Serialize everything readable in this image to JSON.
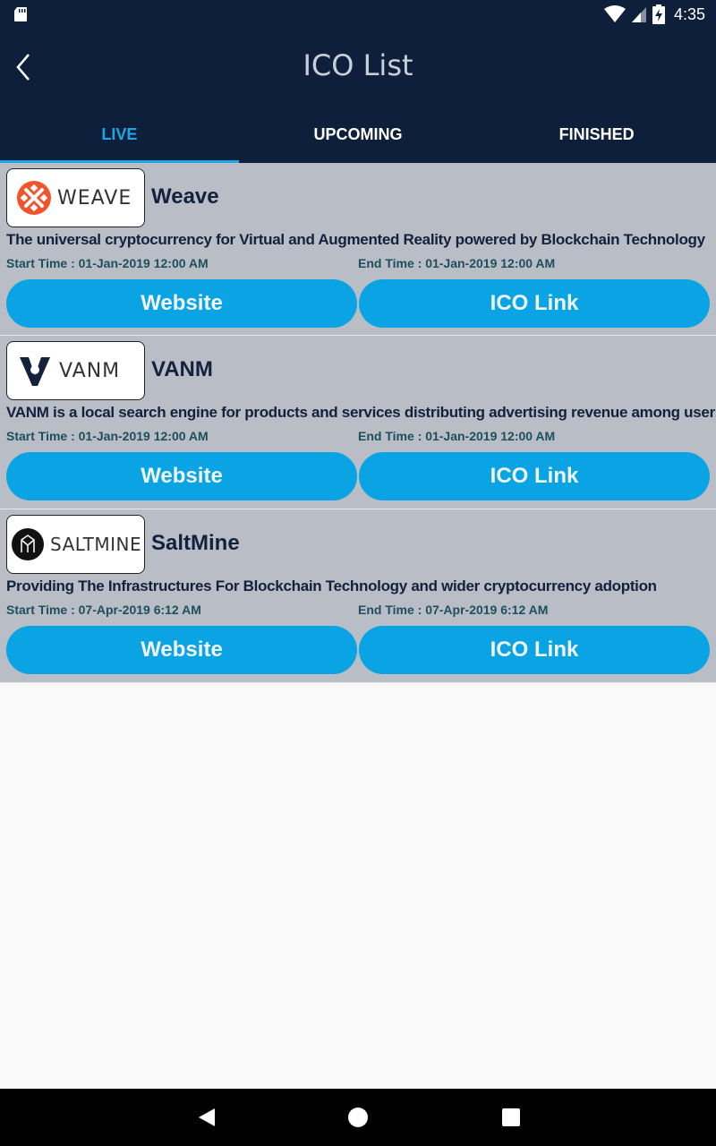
{
  "status_bar": {
    "time": "4:35"
  },
  "header": {
    "title": "ICO List"
  },
  "tabs": [
    {
      "label": "LIVE",
      "active": true
    },
    {
      "label": "UPCOMING",
      "active": false
    },
    {
      "label": "FINISHED",
      "active": false
    }
  ],
  "icos": [
    {
      "logo_text": "WEAVE",
      "name": "Weave",
      "description": "The universal cryptocurrency for Virtual and Augmented Reality powered by Blockchain Technology",
      "start_time": "Start Time : 01-Jan-2019 12:00 AM",
      "end_time": "End Time : 01-Jan-2019 12:00 AM",
      "website_label": "Website",
      "ico_link_label": "ICO Link"
    },
    {
      "logo_text": "VANM",
      "name": "VANM",
      "description": "VANM is a local search engine for products and services distributing advertising revenue among users",
      "start_time": "Start Time : 01-Jan-2019 12:00 AM",
      "end_time": "End Time : 01-Jan-2019 12:00 AM",
      "website_label": "Website",
      "ico_link_label": "ICO Link"
    },
    {
      "logo_text": "SALTMINE",
      "name": "SaltMine",
      "description": "Providing The Infrastructures For Blockchain Technology and wider cryptocurrency adoption",
      "start_time": "Start Time : 07-Apr-2019 6:12 AM",
      "end_time": "End Time : 07-Apr-2019 6:12 AM",
      "website_label": "Website",
      "ico_link_label": "ICO Link"
    }
  ],
  "colors": {
    "primary_dark": "#0e1f3b",
    "accent": "#1ca6e3",
    "button": "#0aa3e4",
    "card_bg": "#b8bdc6"
  }
}
